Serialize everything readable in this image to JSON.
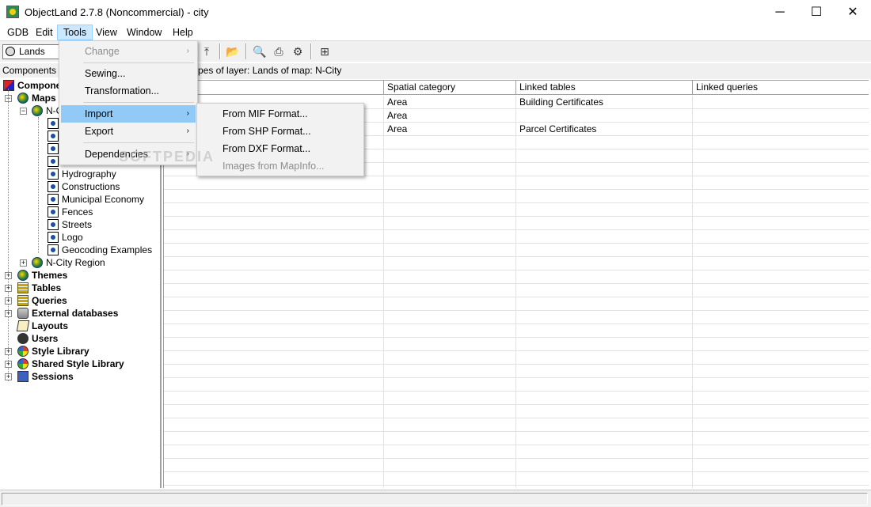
{
  "window": {
    "title": "ObjectLand 2.7.8 (Noncommercial) - city",
    "minimize": "─",
    "maximize": "☐",
    "close": "✕"
  },
  "menubar": [
    "GDB",
    "Edit",
    "Tools",
    "View",
    "Window",
    "Help"
  ],
  "toolbar": {
    "layer_combo": "Lands"
  },
  "components_label": "Components",
  "tree": {
    "root": "Components",
    "maps": "Maps",
    "map_ncity": "N-City",
    "layers": [
      "Hydrography",
      "Constructions",
      "Municipal Economy",
      "Fences",
      "Streets",
      "Logo",
      "Geocoding Examples"
    ],
    "region": "N-City Region",
    "top_items": [
      "Themes",
      "Tables",
      "Queries",
      "External databases",
      "Layouts",
      "Users",
      "Style Library",
      "Shared Style Library",
      "Sessions"
    ]
  },
  "main_header": "pes of layer: Lands of map: N-City",
  "grid": {
    "columns": [
      "",
      "Spatial category",
      "Linked tables",
      "Linked queries"
    ],
    "rows": [
      [
        "",
        "Area",
        "Building Certificates",
        ""
      ],
      [
        "",
        "Area",
        "",
        ""
      ],
      [
        "",
        "Area",
        "Parcel Certificates",
        ""
      ]
    ]
  },
  "tools_menu": {
    "items": [
      {
        "label": "Change",
        "disabled": true,
        "submenu": true
      },
      {
        "label": "Sewing..."
      },
      {
        "label": "Transformation..."
      },
      {
        "label": "Import",
        "submenu": true,
        "highlighted": true
      },
      {
        "label": "Export",
        "submenu": true
      },
      {
        "label": "Dependencies",
        "submenu": true
      }
    ]
  },
  "import_submenu": {
    "items": [
      {
        "label": "From MIF Format..."
      },
      {
        "label": "From SHP Format..."
      },
      {
        "label": "From DXF Format..."
      },
      {
        "label": "Images from MapInfo...",
        "disabled": true
      }
    ]
  },
  "watermark": "SOFTPEDIA",
  "colors": {
    "menu_active": "#cce8ff",
    "menu_highlight": "#91c9f7",
    "chrome": "#f0f0f0"
  }
}
